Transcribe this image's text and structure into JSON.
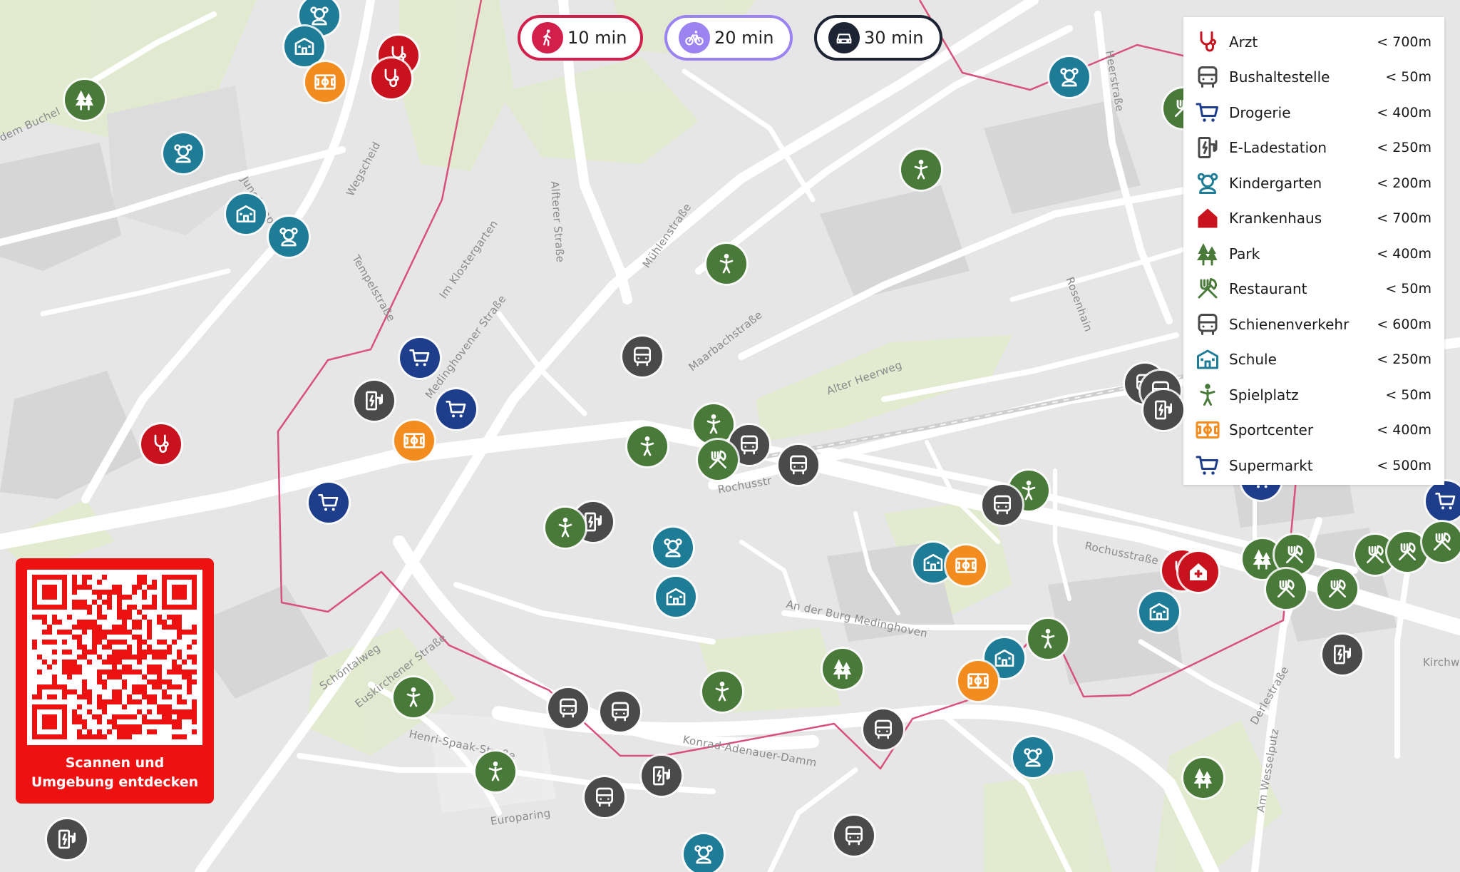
{
  "colors": {
    "accent_walk": "#d21f4c",
    "accent_bike": "#9c83f2",
    "accent_car": "#1d2433",
    "isochrone": "#d8517a",
    "category": {
      "arzt": "#c8131f",
      "bus": "#4a4a4a",
      "drogerie": "#1e3e8c",
      "eladen": "#4a4a4a",
      "kita": "#1f7c97",
      "krankenhaus": "#c8131f",
      "park": "#4a7a3a",
      "restaurant": "#4a7a3a",
      "schiene": "#4a4a4a",
      "schule": "#1f7c97",
      "spielplatz": "#4a7a3a",
      "sport": "#f38c1e",
      "supermarkt": "#1e3e8c"
    }
  },
  "modes": [
    {
      "id": "walk",
      "label": "10 min",
      "icon": "walking-icon"
    },
    {
      "id": "bike",
      "label": "20 min",
      "icon": "bicycle-icon"
    },
    {
      "id": "car",
      "label": "30 min",
      "icon": "car-icon"
    }
  ],
  "legend": [
    {
      "cat": "arzt",
      "label": "Arzt",
      "distance": "< 700m",
      "icon": "stethoscope-icon"
    },
    {
      "cat": "bus",
      "label": "Bushaltestelle",
      "distance": "< 50m",
      "icon": "bus-icon"
    },
    {
      "cat": "drogerie",
      "label": "Drogerie",
      "distance": "< 400m",
      "icon": "cart-icon"
    },
    {
      "cat": "eladen",
      "label": "E-Ladestation",
      "distance": "< 250m",
      "icon": "charging-station-icon"
    },
    {
      "cat": "kita",
      "label": "Kindergarten",
      "distance": "< 200m",
      "icon": "teddy-bear-icon"
    },
    {
      "cat": "krankenhaus",
      "label": "Krankenhaus",
      "distance": "< 700m",
      "icon": "hospital-icon"
    },
    {
      "cat": "park",
      "label": "Park",
      "distance": "< 400m",
      "icon": "trees-icon"
    },
    {
      "cat": "restaurant",
      "label": "Restaurant",
      "distance": "< 50m",
      "icon": "fork-knife-icon"
    },
    {
      "cat": "schiene",
      "label": "Schienenverkehr",
      "distance": "< 600m",
      "icon": "train-icon"
    },
    {
      "cat": "schule",
      "label": "Schule",
      "distance": "< 250m",
      "icon": "school-icon"
    },
    {
      "cat": "spielplatz",
      "label": "Spielplatz",
      "distance": "< 50m",
      "icon": "playground-icon"
    },
    {
      "cat": "sport",
      "label": "Sportcenter",
      "distance": "< 400m",
      "icon": "sport-field-icon"
    },
    {
      "cat": "supermarkt",
      "label": "Supermarkt",
      "distance": "< 500m",
      "icon": "cart-icon"
    }
  ],
  "streets": [
    "Wegscheid",
    "Alfterer Straße",
    "Mühlenstraße",
    "Maarbachstraße",
    "Alter Heerweg",
    "Rosenhain",
    "Im Klostergarten",
    "Jungfernpfad",
    "Tempelstraße",
    "Medinghovener Straße",
    "Euskirchener Straße",
    "Henri-Spaak-Straße",
    "Europaring",
    "Konrad-Adenauer-Damm",
    "Rochusstraße",
    "An der Burg Medinghoven",
    "Derlestraße",
    "Am Wesselputz",
    "Schöntalweg",
    "Rochusstr",
    "Kirchw",
    "dem Buchel",
    "Heerstraße"
  ],
  "qr": {
    "caption_line1": "Scannen und",
    "caption_line2": "Umgebung entdecken"
  }
}
